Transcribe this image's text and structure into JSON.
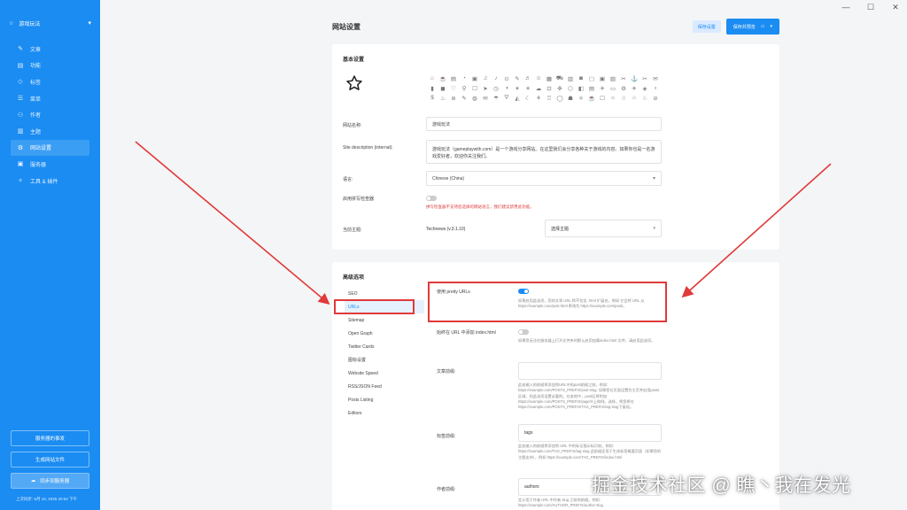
{
  "sidebar": {
    "site_name": "游戏玩法",
    "items": [
      {
        "label": "文章",
        "icon": "pencil-icon"
      },
      {
        "label": "功能",
        "icon": "file-icon"
      },
      {
        "label": "标签",
        "icon": "tag-icon"
      },
      {
        "label": "菜单",
        "icon": "menu-icon"
      },
      {
        "label": "作者",
        "icon": "users-icon"
      },
      {
        "label": "主题",
        "icon": "columns-icon"
      },
      {
        "label": "网站设置",
        "icon": "gear-icon"
      },
      {
        "label": "服务器",
        "icon": "server-icon"
      },
      {
        "label": "工具 & 插件",
        "icon": "wrench-icon"
      }
    ],
    "buttons": [
      "服务器的事发",
      "生成网站文件",
      "同步到服务器"
    ],
    "status": "上次同步: 5月 16, 2025 20:54 下午"
  },
  "header": {
    "title": "网站设置",
    "save_label": "保存设置",
    "preview_label": "保存并预览"
  },
  "basic": {
    "title": "基本设置",
    "site_name_label": "网站名称:",
    "site_name_value": "游戏玩法",
    "description_label": "Site description (internal):",
    "description_value": "游戏玩法（gameplaywith.com）是一个游戏分享网站。在这里我们会分享各种关于游戏的内容。如果你也是一名游戏爱好者，欢迎你关注我们。",
    "language_label": "语言:",
    "language_value": "Chinese (China)",
    "spellcheck_label": "启用拼写检查器",
    "spellcheck_on": false,
    "spellcheck_note": "拼写检查器不支持您选择的网站语言，我们建议禁用此功能。",
    "theme_label": "当前主题:",
    "theme_value": "Technews (v.3.1.10)",
    "theme_select": "选择主题"
  },
  "advanced": {
    "title": "高级选项",
    "menu": [
      "SEO",
      "URLs",
      "Sitemap",
      "Open Graph",
      "Twitter Cards",
      "图标设置",
      "Website Speed",
      "RSS/JSON Feed",
      "Posts Listing",
      "Editors"
    ],
    "active_index": 1,
    "pretty_urls_label": "使用 pretty URLs",
    "pretty_urls_on": true,
    "pretty_urls_note": "如果启用此选项，您的文章 URL 将不包含 .html 扩展名。例如 它会将 URL 从 https://example.com/post.html 更改为 https://example.com/post/。",
    "index_html_label": "始终在 URL 中添加 index.html",
    "index_html_on": false,
    "index_html_note": "如果您无法在服务器上打开文件夹时默认启用加载index.html 文件，请启用此选项。",
    "post_prefix_label": "文章前缀:",
    "post_prefix_value": "",
    "post_prefix_note": "此处输入的前缀将添加到URL中的post前缀之前。例如: https://example.com/POSTS_PREFIX/post-slug. 如果您在页面设置为主页并启用posts区域，则此选项设置必要的。在本地中，post区将附加https://example.com/POSTS_PREFIX/page/X上和例。选择，将您将在https://example.com/POSTS_PREFIX/TAG_PREFIX/tag-slug下复现。",
    "tag_prefix_label": "标签前缀:",
    "tag_prefix_value": "tags",
    "tag_prefix_note": "此处输入的前缀将添加到 URL 中的标记指示标识前。例如: https://example.com/TAG_PREFIX/tag-slug 此前缀还用于生成标签概要页面（如果您的主题支持），例如 https://example.com/TAG_PREFIX/index.html",
    "author_prefix_label": "作者前缀:",
    "author_prefix_value": "authors",
    "author_prefix_note": "定义用于作者 URL 中作者 slug 之前的前缀。例如: https://example.com/AUTHOR_PREFIX/author-slug"
  },
  "icon_grid": [
    "⌂",
    "☕",
    "▤",
    "◔",
    "▣",
    "♫",
    "♪",
    "⊙",
    "✎",
    "♬",
    "☺",
    "▦",
    "⛟",
    "▥",
    "◙",
    "▢",
    "▣",
    "▧",
    "✂",
    "⚓",
    "✂",
    "✉",
    "▮",
    "◼",
    "♡",
    "⚲",
    "☐",
    "➤",
    "◷",
    "◑",
    "✶",
    "☀",
    "☁",
    "⊡",
    "✜",
    "⬡",
    "◧",
    "▤",
    "✈",
    "▭",
    "⚙",
    "✈",
    "◈",
    "♁",
    "$",
    "♨",
    "⊛",
    "✎",
    "◍",
    "✉",
    "☂",
    "⛛",
    "◭",
    "☾",
    "⚘",
    "♖",
    "◯",
    "☗",
    "⚛",
    "☕",
    "☐",
    "☼",
    "☃",
    "⌂",
    "♘",
    "⊘"
  ],
  "colors": {
    "brand": "#1a8cf2",
    "highlight": "#e03a3a"
  },
  "watermark": "掘金技术社区 @ 瞧丶我在发光"
}
